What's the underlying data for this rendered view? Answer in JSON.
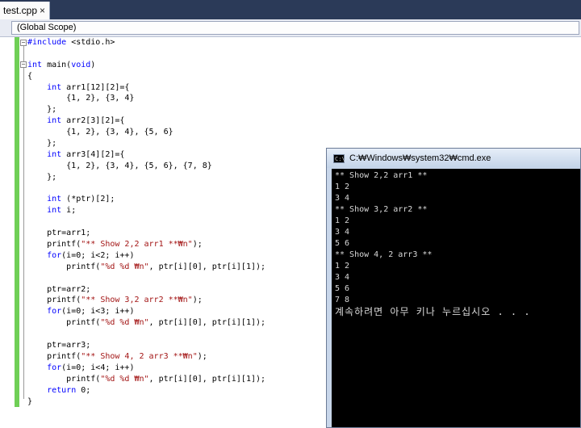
{
  "tab": {
    "title": "test.cpp",
    "close": "×"
  },
  "scope": {
    "value": "(Global Scope)"
  },
  "code_lines": [
    "#include <stdio.h>",
    "",
    "int main(void)",
    "{",
    "    int arr1[12][2]={",
    "        {1, 2}, {3, 4}",
    "    };",
    "    int arr2[3][2]={",
    "        {1, 2}, {3, 4}, {5, 6}",
    "    };",
    "    int arr3[4][2]={",
    "        {1, 2}, {3, 4}, {5, 6}, {7, 8}",
    "    };",
    "",
    "    int (*ptr)[2];",
    "    int i;",
    "",
    "    ptr=arr1;",
    "    printf(\"** Show 2,2 arr1 **₩n\");",
    "    for(i=0; i<2; i++)",
    "        printf(\"%d %d ₩n\", ptr[i][0], ptr[i][1]);",
    "",
    "    ptr=arr2;",
    "    printf(\"** Show 3,2 arr2 **₩n\");",
    "    for(i=0; i<3; i++)",
    "        printf(\"%d %d ₩n\", ptr[i][0], ptr[i][1]);",
    "",
    "    ptr=arr3;",
    "    printf(\"** Show 4, 2 arr3 **₩n\");",
    "    for(i=0; i<4; i++)",
    "        printf(\"%d %d ₩n\", ptr[i][0], ptr[i][1]);",
    "    return 0;",
    "}"
  ],
  "console": {
    "title": "C:₩Windows₩system32₩cmd.exe",
    "icon": "C:\\",
    "lines": [
      "** Show 2,2 arr1 **",
      "1 2",
      "3 4",
      "** Show 3,2 arr2 **",
      "1 2",
      "3 4",
      "5 6",
      "** Show 4, 2 arr3 **",
      "1 2",
      "3 4",
      "5 6",
      "7 8"
    ],
    "prompt": "계속하려면 아무 키나 누르십시오 . . ."
  },
  "colors": {
    "keyword": "#0000ff",
    "string": "#a31515",
    "gutter": "#6fcf56",
    "tabstrip": "#2b3a58",
    "console_bg": "#000000",
    "console_fg": "#d8d8d8"
  }
}
